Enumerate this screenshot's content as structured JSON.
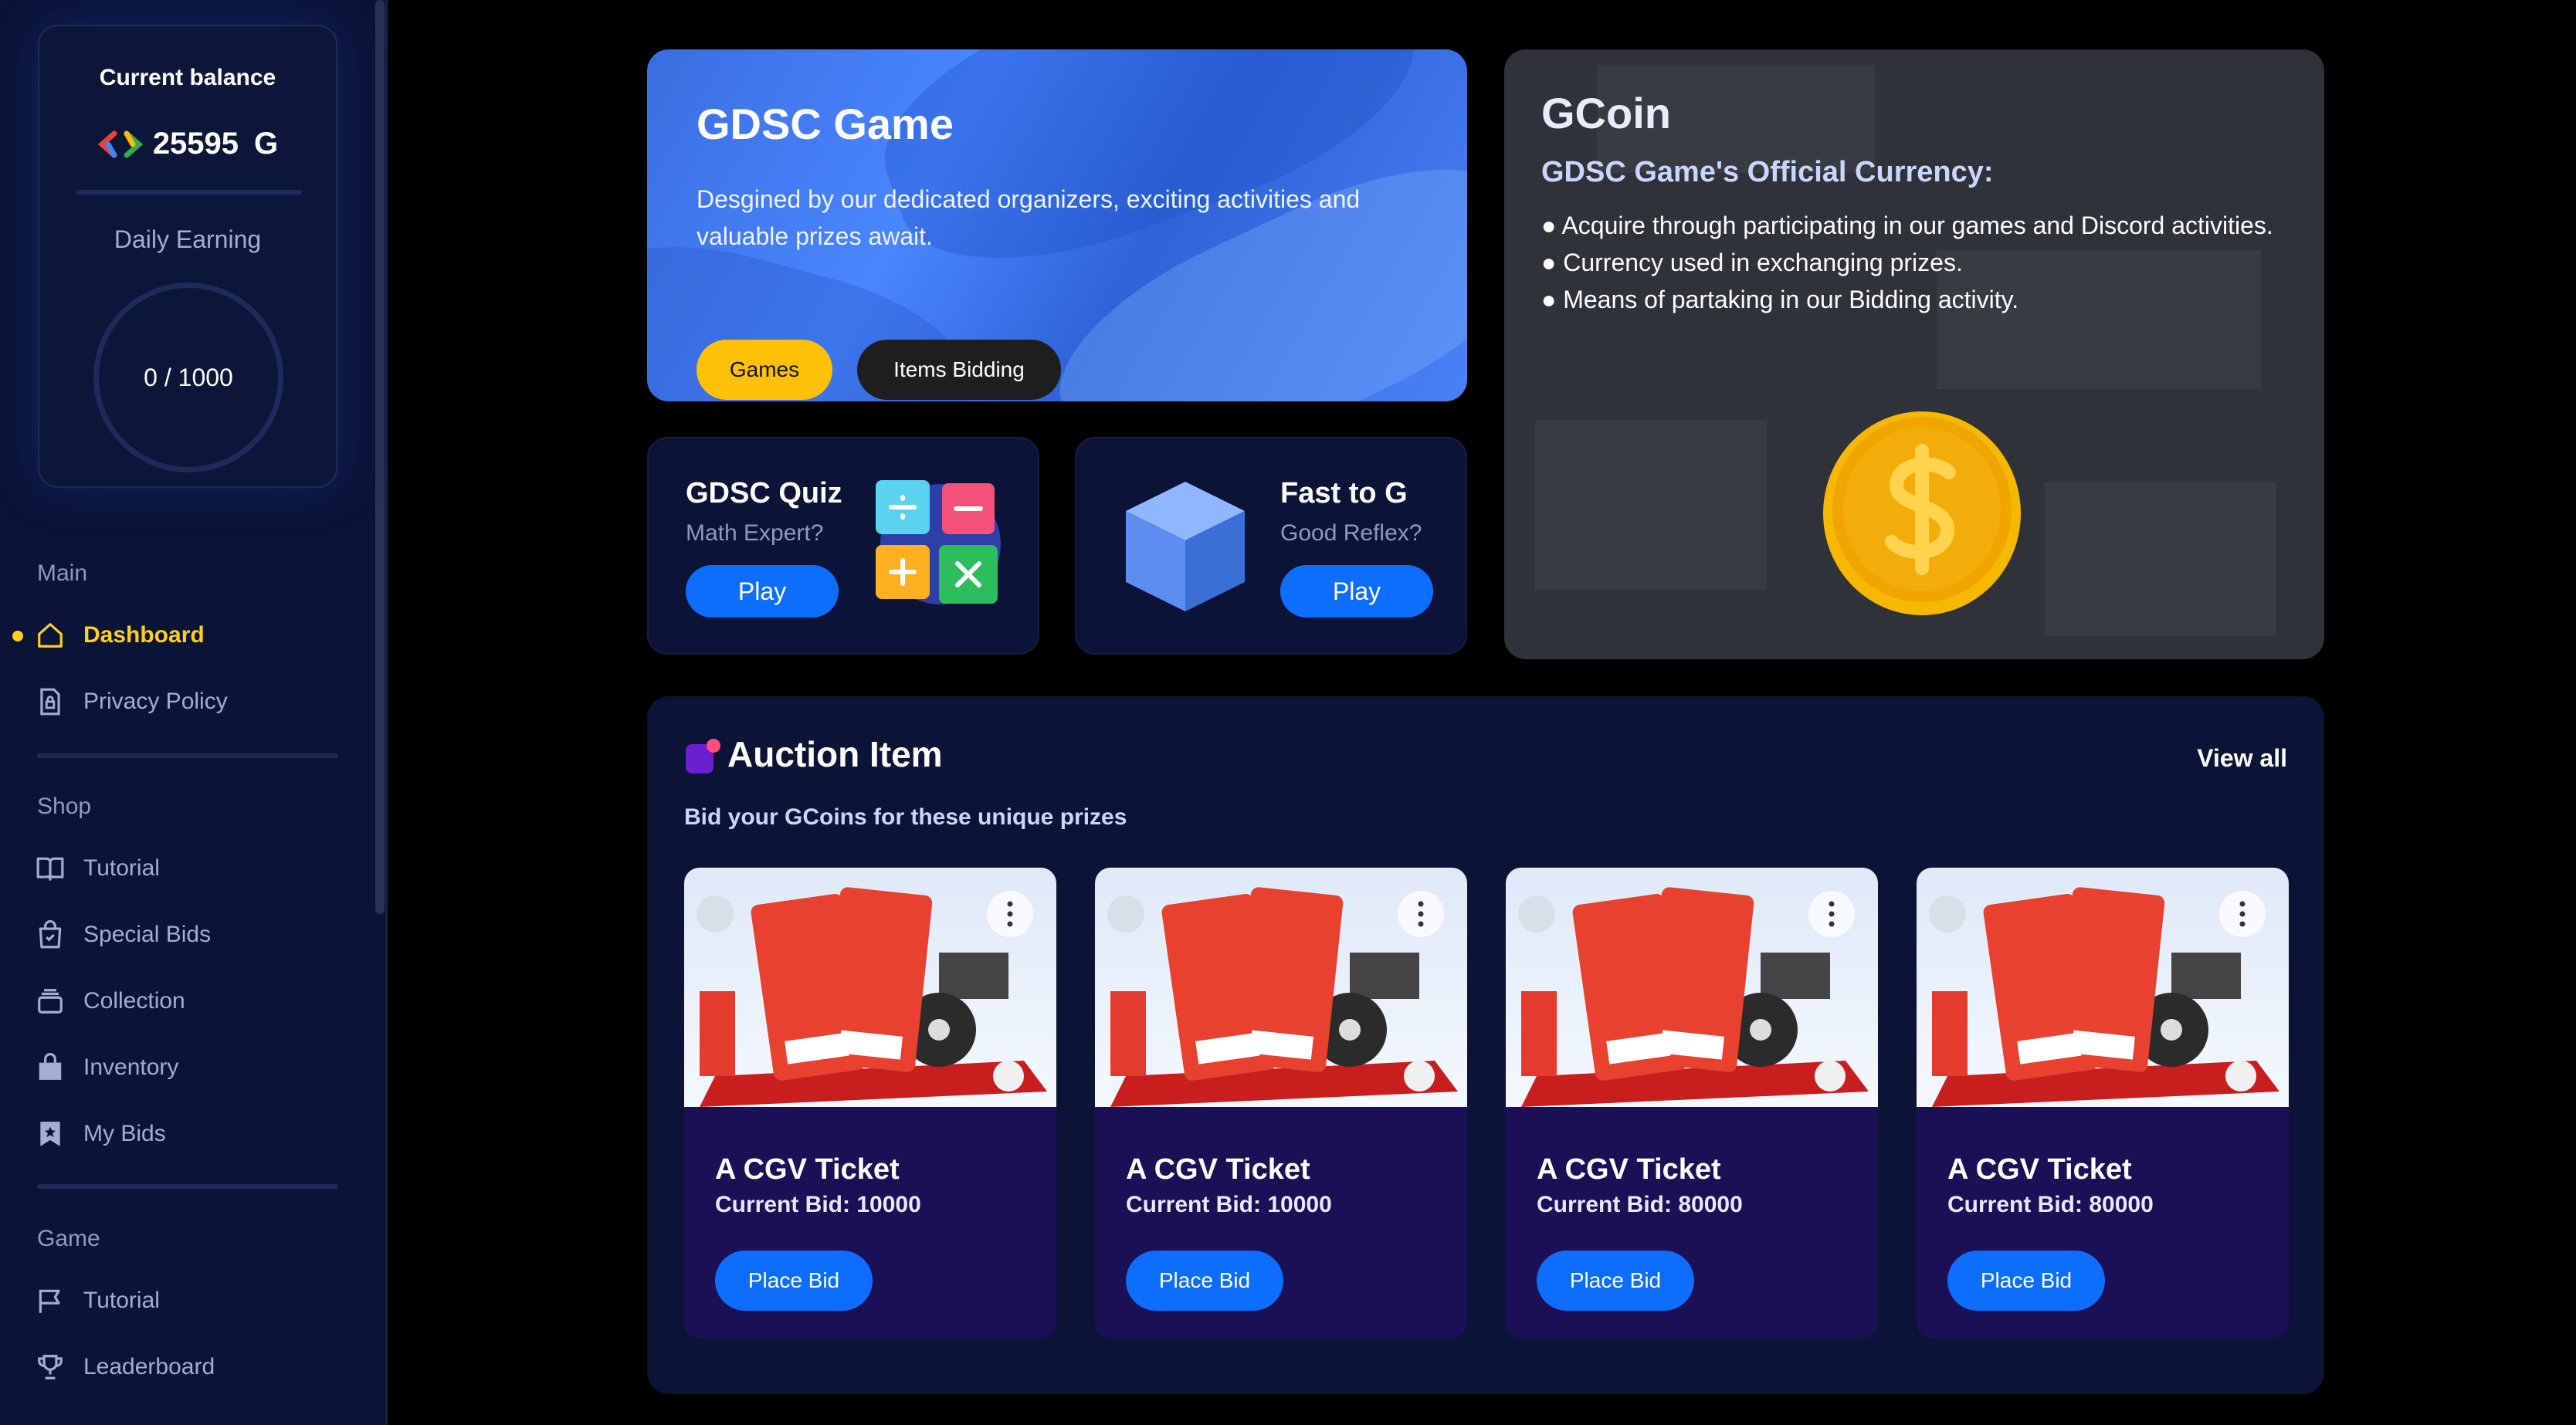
{
  "sidebar": {
    "balance_title": "Current balance",
    "balance_value": "25595",
    "balance_unit": "G",
    "daily_label": "Daily Earning",
    "daily_progress": "0 / 1000",
    "sections": {
      "main": "Main",
      "shop": "Shop",
      "game": "Game"
    },
    "items": {
      "dashboard": "Dashboard",
      "privacy": "Privacy Policy",
      "shop_tutorial": "Tutorial",
      "special_bids": "Special Bids",
      "collection": "Collection",
      "inventory": "Inventory",
      "my_bids": "My Bids",
      "game_tutorial": "Tutorial",
      "leaderboard": "Leaderboard"
    },
    "active_color": "#ffce20"
  },
  "hero": {
    "title": "GDSC Game",
    "description": "Desgined by our dedicated organizers, exciting activities and valuable prizes await.",
    "games_button": "Games",
    "bidding_button": "Items Bidding"
  },
  "quiz": {
    "title": "GDSC Quiz",
    "subtitle": "Math Expert?",
    "play_button": "Play"
  },
  "fast": {
    "title": "Fast to G",
    "subtitle": "Good Reflex?",
    "play_button": "Play"
  },
  "gcoin": {
    "title": "GCoin",
    "subtitle": "GDSC Game's Official Currency:",
    "bullets": {
      "b1": "● Acquire through participating in our games and Discord activities.",
      "b2": "● Currency used in exchanging prizes.",
      "b3": "● Means of partaking in our Bidding activity."
    }
  },
  "auction": {
    "title": "Auction Item",
    "view_all": "View all",
    "subtitle": "Bid your GCoins for these unique prizes",
    "items": [
      {
        "name": "A CGV Ticket",
        "bid": "Current Bid: 10000",
        "button": "Place Bid"
      },
      {
        "name": "A CGV Ticket",
        "bid": "Current Bid: 10000",
        "button": "Place Bid"
      },
      {
        "name": "A CGV Ticket",
        "bid": "Current Bid: 80000",
        "button": "Place Bid"
      },
      {
        "name": "A CGV Ticket",
        "bid": "Current Bid: 80000",
        "button": "Place Bid"
      }
    ]
  },
  "colors": {
    "sidebar_bg": "#0b1437",
    "primary_button": "#0d6efd",
    "accent_yellow": "#ffc107",
    "item_card_bg": "#1b0f55"
  }
}
